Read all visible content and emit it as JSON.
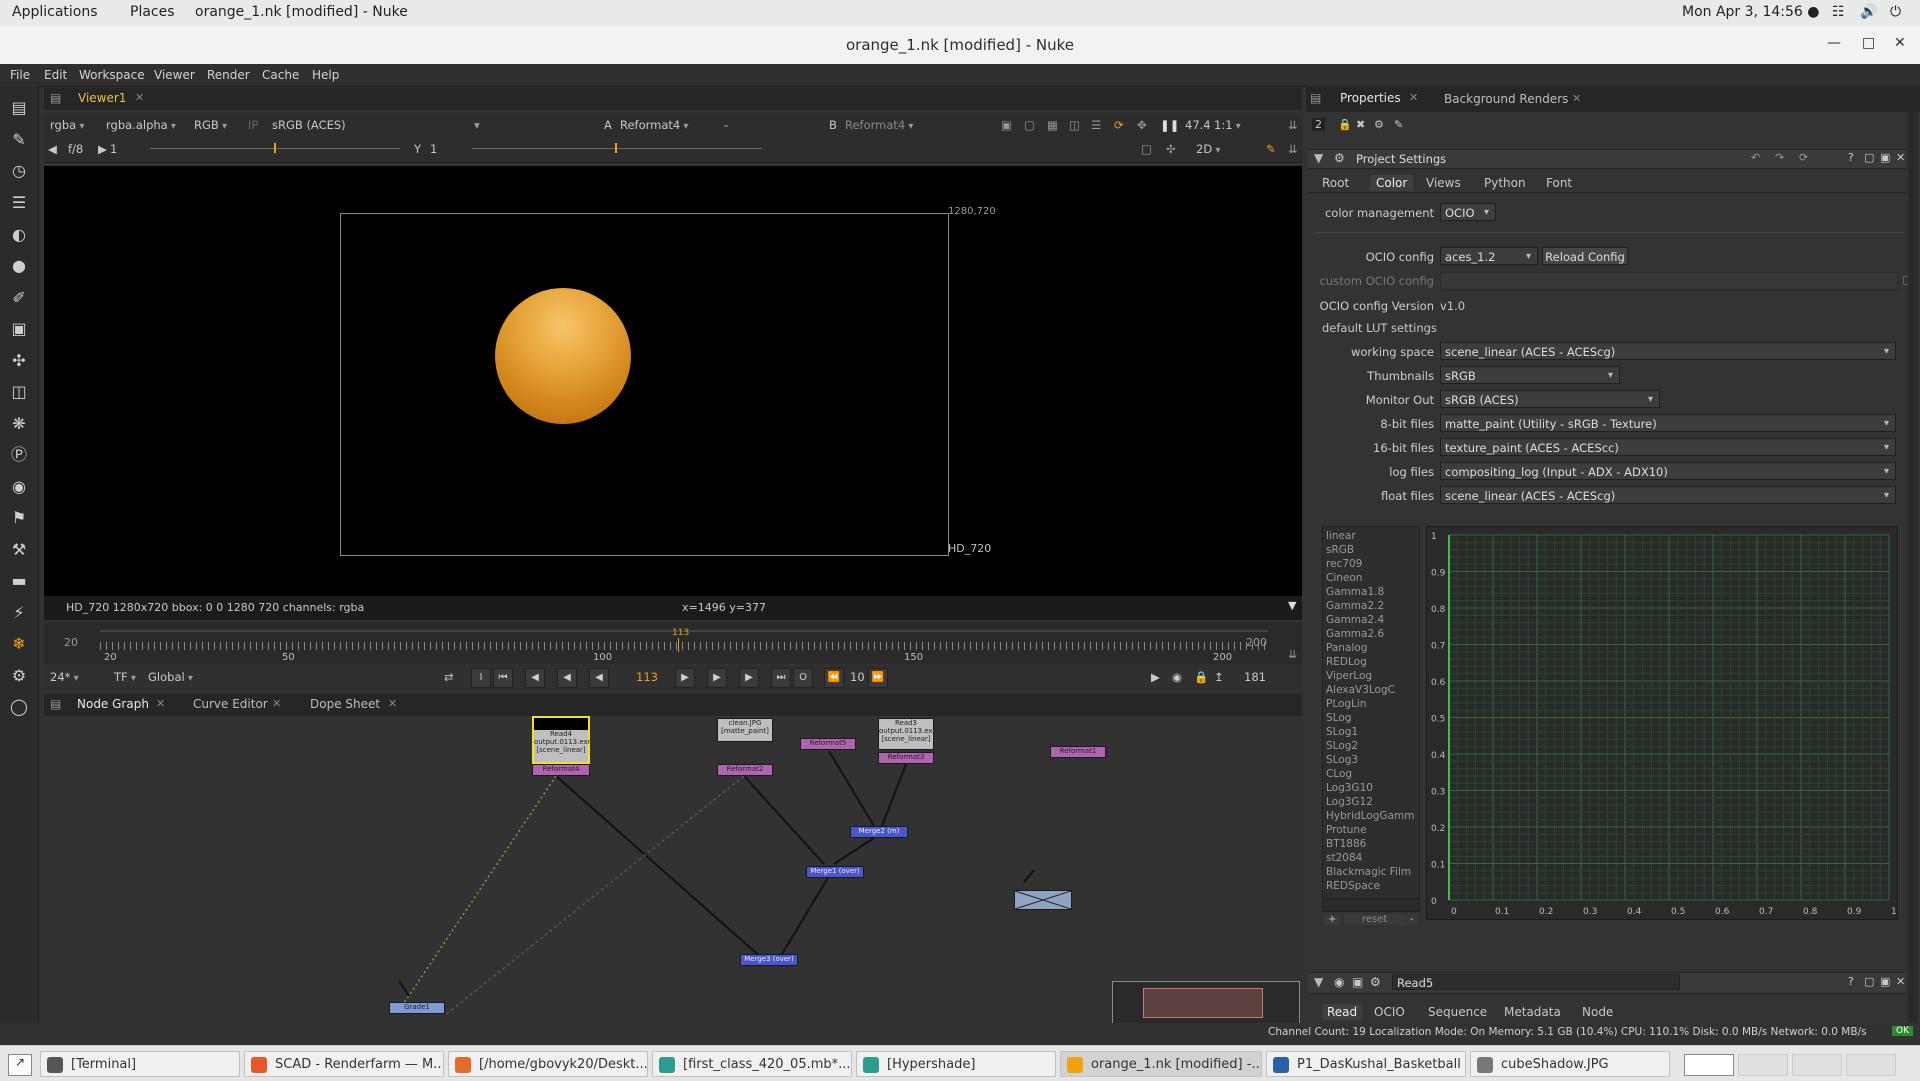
{
  "gnome_bar": {
    "applications": "Applications",
    "places": "Places",
    "window_title": "orange_1.nk [modified] - Nuke",
    "clock": "Mon Apr  3, 14:56 ●"
  },
  "window": {
    "title": "orange_1.nk [modified] - Nuke"
  },
  "menu": [
    "File",
    "Edit",
    "Workspace",
    "Viewer",
    "Render",
    "Cache",
    "Help"
  ],
  "left_toolbar_icons": [
    "viewer-icon",
    "paint-icon",
    "time-icon",
    "channel-icon",
    "color-icon",
    "filter-icon",
    "draw-icon",
    "merge-icon",
    "transform-icon",
    "3d-icon",
    "particles-icon",
    "deep-icon",
    "views-icon",
    "metadata-icon",
    "toolsets-icon",
    "other-icon",
    "furnace-icon",
    "cara-icon",
    "nuke-logo-icon"
  ],
  "viewer": {
    "tab": "Viewer1",
    "channels": "rgba",
    "alpha": "rgba.alpha",
    "display": "RGB",
    "ip": "IP",
    "colorspace": "sRGB (ACES)",
    "a_label": "A",
    "a_input": "Reformat4",
    "comp": "-",
    "b_label": "B",
    "b_input": "Reformat4",
    "gain_value": "47.4",
    "zoom": "1:1",
    "fstop": "f/8",
    "gain_field": "1",
    "y_label": "Y",
    "gamma_field": "1",
    "view_mode": "2D",
    "frame_label_top": "1280,720",
    "frame_label_bottom": "HD_720",
    "status_left": "HD_720 1280x720  bbox: 0 0 1280 720 channels: rgba",
    "status_coords": "x=1496 y=377"
  },
  "timeline": {
    "in": "20",
    "out": "200",
    "current": "113",
    "ticks": [
      "20",
      "50",
      "100",
      "150",
      "200"
    ],
    "fps": "24*",
    "tf": "TF",
    "global": "Global",
    "frame_field": "113",
    "step": "10",
    "end_field": "181"
  },
  "node_graph": {
    "tabs": [
      "Node Graph",
      "Curve Editor",
      "Dope Sheet"
    ],
    "nodes": [
      {
        "name": "Read4",
        "label": "Read4\noutput.0113.exr\n[scene_linear]"
      },
      {
        "name": "Reformat4",
        "label": "Reformat4"
      },
      {
        "name": "clean_jpg",
        "label": "clean.JPG\n[matte_paint]"
      },
      {
        "name": "Reformat2",
        "label": "Reformat2"
      },
      {
        "name": "Reformat5",
        "label": "Reformat5"
      },
      {
        "name": "Read3",
        "label": "Read3\noutput.0113.exr\n[scene_linear]"
      },
      {
        "name": "Reformat3",
        "label": "Reformat3"
      },
      {
        "name": "Reformat1",
        "label": "Reformat1"
      },
      {
        "name": "Merge2",
        "label": "Merge2 (m)"
      },
      {
        "name": "Merge1",
        "label": "Merge1 (over)"
      },
      {
        "name": "Merge3",
        "label": "Merge3 (over)"
      },
      {
        "name": "Viewer",
        "label": "Viewer"
      },
      {
        "name": "Grade1",
        "label": "Grade1"
      }
    ]
  },
  "properties": {
    "tabs": [
      "Properties",
      "Background Renders"
    ],
    "count": "2",
    "panel_title": "Project Settings",
    "sub_tabs": [
      "Root",
      "Color",
      "Views",
      "Python",
      "Font"
    ],
    "color_management_label": "color management",
    "color_management": "OCIO",
    "ocio_config_label": "OCIO config",
    "ocio_config": "aces_1.2",
    "reload": "Reload Config",
    "custom_ocio_label": "custom OCIO config",
    "ocio_version_label": "OCIO config Version",
    "ocio_version": "v1.0",
    "default_lut_label": "default LUT settings",
    "rows": [
      {
        "label": "working space",
        "value": "scene_linear (ACES - ACEScg)"
      },
      {
        "label": "Thumbnails",
        "value": "sRGB"
      },
      {
        "label": "Monitor Out",
        "value": "sRGB (ACES)"
      },
      {
        "label": "8-bit files",
        "value": "matte_paint (Utility - sRGB - Texture)"
      },
      {
        "label": "16-bit files",
        "value": "texture_paint (ACES - ACEScc)"
      },
      {
        "label": "log files",
        "value": "compositing_log (Input - ADX - ADX10)"
      },
      {
        "label": "float files",
        "value": "scene_linear (ACES - ACEScg)"
      }
    ],
    "lut_list": [
      "linear",
      "sRGB",
      "rec709",
      "Cineon",
      "Gamma1.8",
      "Gamma2.2",
      "Gamma2.4",
      "Gamma2.6",
      "Panalog",
      "REDLog",
      "ViperLog",
      "AlexaV3LogC",
      "PLogLin",
      "SLog",
      "SLog1",
      "SLog2",
      "SLog3",
      "CLog",
      "Log3G10",
      "Log3G12",
      "HybridLogGamm",
      "Protune",
      "BT1886",
      "st2084",
      "Blackmagic Film",
      "REDSpace"
    ],
    "add_btn": "+",
    "reset_btn": "reset",
    "remove_btn": "-",
    "graph_y": [
      "1",
      "0.9",
      "0.8",
      "0.7",
      "0.6",
      "0.5",
      "0.4",
      "0.3",
      "0.2",
      "0.1",
      "0"
    ],
    "graph_x": [
      "0",
      "0.1",
      "0.2",
      "0.3",
      "0.4",
      "0.5",
      "0.6",
      "0.7",
      "0.8",
      "0.9",
      "1"
    ],
    "read_panel": {
      "name": "Read5",
      "tabs": [
        "Read",
        "OCIO",
        "Sequence",
        "Metadata",
        "Node"
      ]
    }
  },
  "status_bar": {
    "text": "Channel Count: 19  Localization Mode: On  Memory: 5.1 GB (10.4%)  CPU: 110.1%  Disk: 0.0 MB/s  Network: 0.0 MB/s",
    "ok": "OK"
  },
  "taskbar": [
    {
      "label": "[Terminal]",
      "icon": "terminal-icon",
      "color": "#555555"
    },
    {
      "label": "SCAD - Renderfarm — M...",
      "icon": "firefox-icon",
      "color": "#e8562a"
    },
    {
      "label": "[/home/gbovyk20/Deskt...",
      "icon": "houdini-icon",
      "color": "#e66a2c"
    },
    {
      "label": "[first_class_420_05.mb*...",
      "icon": "maya-icon",
      "color": "#2a9d8f"
    },
    {
      "label": "[Hypershade]",
      "icon": "maya-icon",
      "color": "#2a9d8f"
    },
    {
      "label": "orange_1.nk [modified] -...",
      "icon": "nuke-icon",
      "color": "#f2a20f"
    },
    {
      "label": "P1_DasKushal_Basketball",
      "icon": "document-icon",
      "color": "#2b5fa8"
    },
    {
      "label": "cubeShadow.JPG",
      "icon": "image-viewer-icon",
      "color": "#777777"
    }
  ],
  "accent": "#e7c24a"
}
